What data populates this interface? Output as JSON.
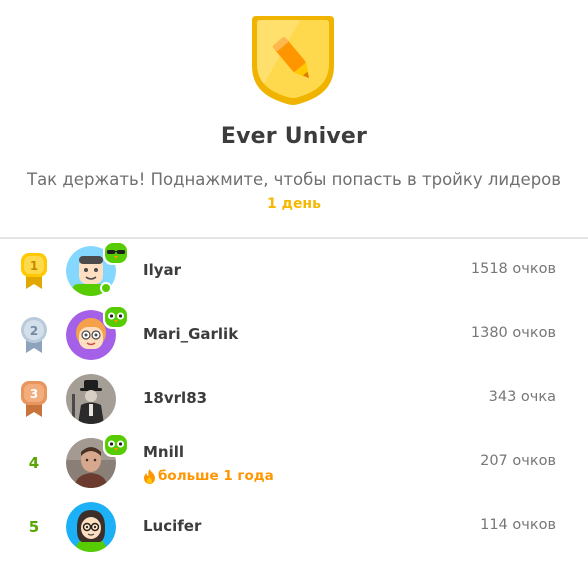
{
  "league": {
    "title": "Ever Univer",
    "subtitle": "Так держать! Поднажмите, чтобы попасть в тройку лидеров",
    "time_left": "1 день"
  },
  "leaderboard": [
    {
      "rank": "1",
      "name": "Ilyar",
      "xp": "1518 очков",
      "streak": ""
    },
    {
      "rank": "2",
      "name": "Mari_Garlik",
      "xp": "1380 очков",
      "streak": ""
    },
    {
      "rank": "3",
      "name": "18vrl83",
      "xp": "343 очка",
      "streak": ""
    },
    {
      "rank": "4",
      "name": "Mnill",
      "xp": "207 очков",
      "streak": "больше 1 года"
    },
    {
      "rank": "5",
      "name": "Lucifer",
      "xp": "114 очков",
      "streak": ""
    }
  ],
  "colors": {
    "gold": "#f5b800",
    "silver": "#a9bcd2",
    "bronze": "#e08f58",
    "rank_text": "#58a700",
    "streak": "#ff9600",
    "online": "#58cc02"
  },
  "icons": [
    "league-badge-icon",
    "gold-medal-icon",
    "silver-medal-icon",
    "bronze-medal-icon",
    "owl-badge-icon",
    "fire-icon"
  ]
}
